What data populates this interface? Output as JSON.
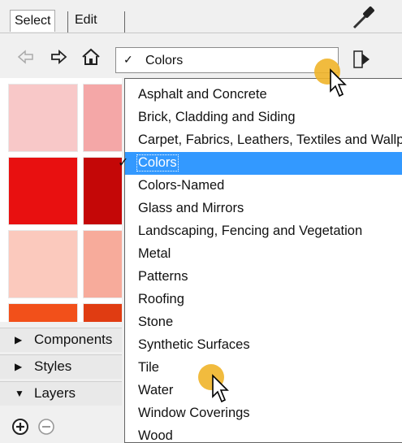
{
  "tabs": {
    "select": "Select",
    "edit": "Edit"
  },
  "combo": {
    "check": "✓",
    "value": "Colors"
  },
  "materials": [
    "Asphalt and Concrete",
    "Brick, Cladding and Siding",
    "Carpet, Fabrics, Leathers, Textiles and Wallpaper",
    "Colors",
    "Colors-Named",
    "Glass and Mirrors",
    "Landscaping, Fencing and Vegetation",
    "Metal",
    "Patterns",
    "Roofing",
    "Stone",
    "Synthetic Surfaces",
    "Tile",
    "Water",
    "Window Coverings",
    "Wood"
  ],
  "selected_material": "Colors",
  "selected_check": "✓",
  "trays": [
    {
      "arrow": "▶",
      "label": "Components"
    },
    {
      "arrow": "▶",
      "label": "Styles"
    },
    {
      "arrow": "▼",
      "label": "Layers"
    }
  ],
  "swatch_colors": [
    "#f8c8c8",
    "#f4a7a7",
    "#e81010",
    "#c40707",
    "#fbc9bd",
    "#f7ab9b",
    "#f2501a",
    "#e03c12"
  ],
  "highlight_color": "#f0b429"
}
